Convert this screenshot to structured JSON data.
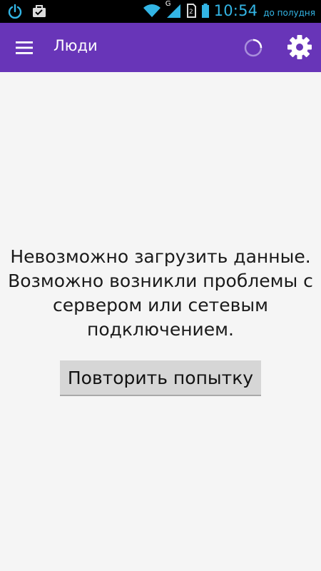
{
  "status_bar": {
    "time": "10:54",
    "ampm": "до полудня",
    "network_label": "G",
    "icons": [
      "power-icon",
      "briefcase-icon",
      "wifi-icon",
      "signal-icon",
      "sim-icon",
      "battery-icon"
    ]
  },
  "app_bar": {
    "title": "Люди",
    "menu_icon": "hamburger-menu-icon",
    "settings_icon": "gear-icon",
    "background_color": "#6835b8"
  },
  "content": {
    "error_lines": [
      "Невозможно загрузить данные.",
      "Возможно возникли проблемы с",
      "сервером или сетевым",
      "подключением."
    ],
    "retry_label": "Повторить попытку"
  }
}
